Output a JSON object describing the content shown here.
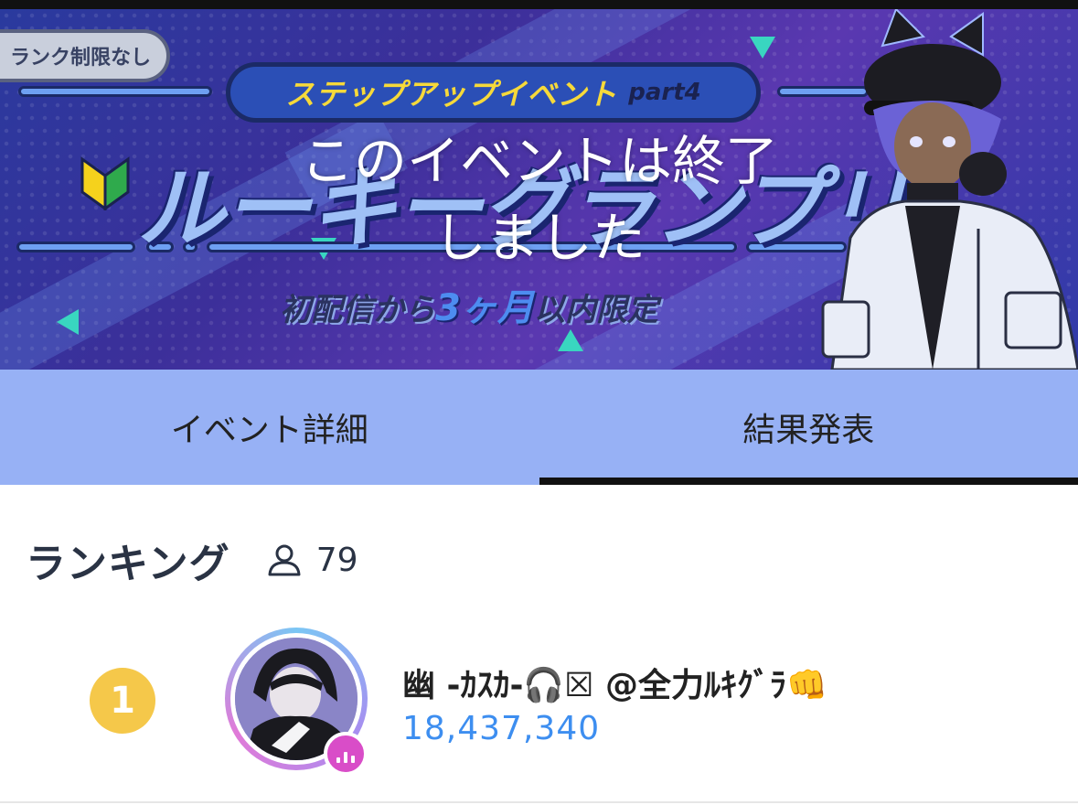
{
  "banner": {
    "rank_badge": "ランク制限なし",
    "subtitle_jp": "ステップアップイベント",
    "subtitle_part": "part4",
    "title": "ルーキーグランプリ",
    "limit_prefix": "初配信から",
    "limit_accent": "3ヶ月",
    "limit_suffix": "以内限定",
    "ended_line1": "このイベントは終了",
    "ended_line2": "しました"
  },
  "tabs": [
    {
      "label": "イベント詳細",
      "active": false
    },
    {
      "label": "結果発表",
      "active": true
    }
  ],
  "ranking": {
    "title": "ランキング",
    "participant_icon": "person-icon",
    "participant_count": "79",
    "entries": [
      {
        "rank": "1",
        "name": "幽 -ｶｽｶ-🎧☒ @全力ﾙｷｸﾞﾗ👊",
        "score": "18,437,340"
      }
    ]
  },
  "colors": {
    "tab_bg": "#97b1f5",
    "score": "#3d8ef0",
    "rank_gold": "#f5c84a",
    "live_badge": "#d94dc8"
  }
}
